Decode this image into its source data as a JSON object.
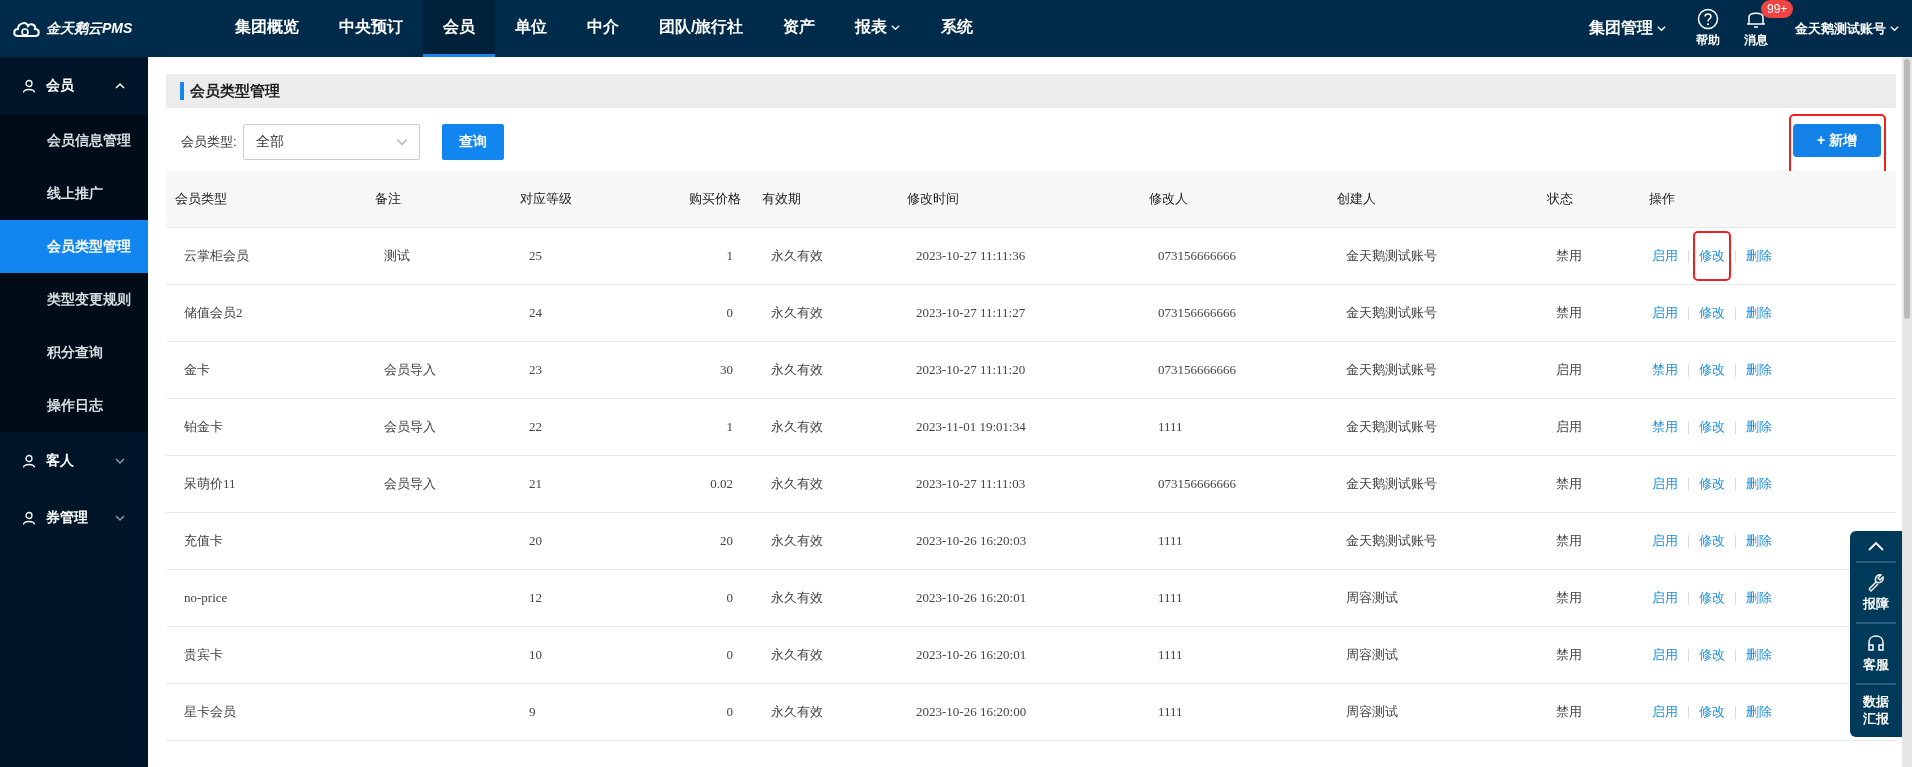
{
  "brand": {
    "name": "金天鹅云PMS"
  },
  "nav": [
    {
      "label": "集团概览",
      "selected": false,
      "dropdown": false
    },
    {
      "label": "中央预订",
      "selected": false,
      "dropdown": false
    },
    {
      "label": "会员",
      "selected": true,
      "dropdown": false
    },
    {
      "label": "单位",
      "selected": false,
      "dropdown": false
    },
    {
      "label": "中介",
      "selected": false,
      "dropdown": false
    },
    {
      "label": "团队/旅行社",
      "selected": false,
      "dropdown": false
    },
    {
      "label": "资产",
      "selected": false,
      "dropdown": false
    },
    {
      "label": "报表",
      "selected": false,
      "dropdown": true
    },
    {
      "label": "系统",
      "selected": false,
      "dropdown": false
    }
  ],
  "header_right": {
    "group": "集团管理",
    "help": "帮助",
    "messages": "消息",
    "badge": "99+",
    "account": "金天鹅测试账号"
  },
  "sidebar": {
    "items": [
      {
        "label": "会员",
        "expanded": true,
        "children": [
          {
            "label": "会员信息管理",
            "selected": false
          },
          {
            "label": "线上推广",
            "selected": false
          },
          {
            "label": "会员类型管理",
            "selected": true
          },
          {
            "label": "类型变更规则",
            "selected": false
          },
          {
            "label": "积分查询",
            "selected": false
          },
          {
            "label": "操作日志",
            "selected": false
          }
        ]
      },
      {
        "label": "客人",
        "expanded": false
      },
      {
        "label": "券管理",
        "expanded": false
      }
    ]
  },
  "page": {
    "title": "会员类型管理",
    "filter": {
      "label": "会员类型:",
      "value": "全部"
    },
    "query_button": "查询",
    "add_button": {
      "label": "+ 新增",
      "highlighted": true
    }
  },
  "table": {
    "columns": [
      "会员类型",
      "备注",
      "对应等级",
      "购买价格",
      "有效期",
      "修改时间",
      "修改人",
      "创建人",
      "状态",
      "操作"
    ],
    "rows": [
      {
        "cells": [
          "云掌柜会员",
          "测试",
          "25",
          "1",
          "永久有效",
          "2023-10-27 11:11:36",
          "073156666666",
          "金天鹅测试账号",
          "禁用"
        ],
        "actions": [
          {
            "label": "启用",
            "highlighted": false
          },
          {
            "label": "修改",
            "highlighted": true
          },
          {
            "label": "删除",
            "highlighted": false
          }
        ]
      },
      {
        "cells": [
          "储值会员2",
          "",
          "24",
          "0",
          "永久有效",
          "2023-10-27 11:11:27",
          "073156666666",
          "金天鹅测试账号",
          "禁用"
        ],
        "actions": [
          {
            "label": "启用",
            "highlighted": false
          },
          {
            "label": "修改",
            "highlighted": false
          },
          {
            "label": "删除",
            "highlighted": false
          }
        ]
      },
      {
        "cells": [
          "金卡",
          "会员导入",
          "23",
          "30",
          "永久有效",
          "2023-10-27 11:11:20",
          "073156666666",
          "金天鹅测试账号",
          "启用"
        ],
        "actions": [
          {
            "label": "禁用",
            "highlighted": false
          },
          {
            "label": "修改",
            "highlighted": false
          },
          {
            "label": "删除",
            "highlighted": false
          }
        ]
      },
      {
        "cells": [
          "铂金卡",
          "会员导入",
          "22",
          "1",
          "永久有效",
          "2023-11-01 19:01:34",
          "1111",
          "金天鹅测试账号",
          "启用"
        ],
        "actions": [
          {
            "label": "禁用",
            "highlighted": false
          },
          {
            "label": "修改",
            "highlighted": false
          },
          {
            "label": "删除",
            "highlighted": false
          }
        ]
      },
      {
        "cells": [
          "呆萌价11",
          "会员导入",
          "21",
          "0.02",
          "永久有效",
          "2023-10-27 11:11:03",
          "073156666666",
          "金天鹅测试账号",
          "禁用"
        ],
        "actions": [
          {
            "label": "启用",
            "highlighted": false
          },
          {
            "label": "修改",
            "highlighted": false
          },
          {
            "label": "删除",
            "highlighted": false
          }
        ]
      },
      {
        "cells": [
          "充值卡",
          "",
          "20",
          "20",
          "永久有效",
          "2023-10-26 16:20:03",
          "1111",
          "金天鹅测试账号",
          "禁用"
        ],
        "actions": [
          {
            "label": "启用",
            "highlighted": false
          },
          {
            "label": "修改",
            "highlighted": false
          },
          {
            "label": "删除",
            "highlighted": false
          }
        ]
      },
      {
        "cells": [
          "no-price",
          "",
          "12",
          "0",
          "永久有效",
          "2023-10-26 16:20:01",
          "1111",
          "周容测试",
          "禁用"
        ],
        "actions": [
          {
            "label": "启用",
            "highlighted": false
          },
          {
            "label": "修改",
            "highlighted": false
          },
          {
            "label": "删除",
            "highlighted": false
          }
        ]
      },
      {
        "cells": [
          "贵宾卡",
          "",
          "10",
          "0",
          "永久有效",
          "2023-10-26 16:20:01",
          "1111",
          "周容测试",
          "禁用"
        ],
        "actions": [
          {
            "label": "启用",
            "highlighted": false
          },
          {
            "label": "修改",
            "highlighted": false
          },
          {
            "label": "删除",
            "highlighted": false
          }
        ]
      },
      {
        "cells": [
          "星卡会员",
          "",
          "9",
          "0",
          "永久有效",
          "2023-10-26 16:20:00",
          "1111",
          "周容测试",
          "禁用"
        ],
        "actions": [
          {
            "label": "启用",
            "highlighted": false
          },
          {
            "label": "修改",
            "highlighted": false
          },
          {
            "label": "删除",
            "highlighted": false
          }
        ]
      }
    ]
  },
  "float_panel": {
    "items": [
      {
        "kind": "top"
      },
      {
        "kind": "wrench",
        "label": "报障"
      },
      {
        "kind": "headset",
        "label": "客服"
      },
      {
        "kind": "text",
        "label": "数据汇报"
      }
    ]
  }
}
